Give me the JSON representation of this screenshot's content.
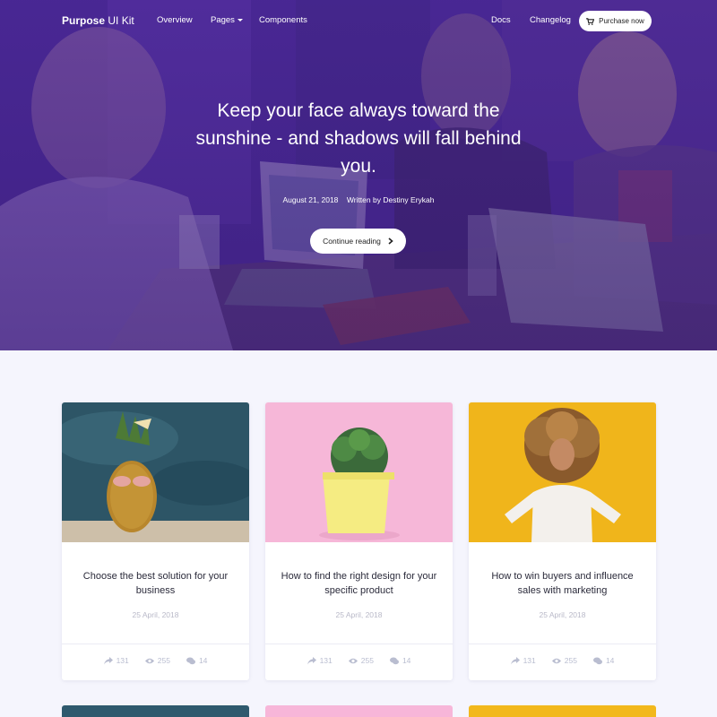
{
  "nav": {
    "brand_bold": "Purpose",
    "brand_rest": "UI Kit",
    "links": [
      {
        "label": "Overview"
      },
      {
        "label": "Pages"
      },
      {
        "label": "Components"
      },
      {
        "label": "Docs"
      },
      {
        "label": "Changelog"
      }
    ],
    "purchase_label": "Purchase now"
  },
  "hero": {
    "title": "Keep your face always toward the sunshine - and shadows will fall behind you.",
    "date": "August 21, 2018",
    "author": "Written by Destiny Erykah",
    "cta_label": "Continue reading"
  },
  "cards": [
    {
      "title": "Choose the best solution for your business",
      "date": "25 April, 2018",
      "shares": "131",
      "views": "255",
      "comments": "14",
      "image_icon": "pineapple-sunglasses-image"
    },
    {
      "title": "How to find the right design for your specific product",
      "date": "25 April, 2018",
      "shares": "131",
      "views": "255",
      "comments": "14",
      "image_icon": "potted-plant-image"
    },
    {
      "title": "How to win buyers and influence sales with marketing",
      "date": "25 April, 2018",
      "shares": "131",
      "views": "255",
      "comments": "14",
      "image_icon": "curly-hair-woman-image"
    }
  ],
  "colors": {
    "hero_purple": "#4a2a9a",
    "page_bg": "#f5f5fd",
    "card_pink": "#f7b6d9",
    "card_yellow": "#f2b81c",
    "card_blue": "#2f5a6e"
  }
}
